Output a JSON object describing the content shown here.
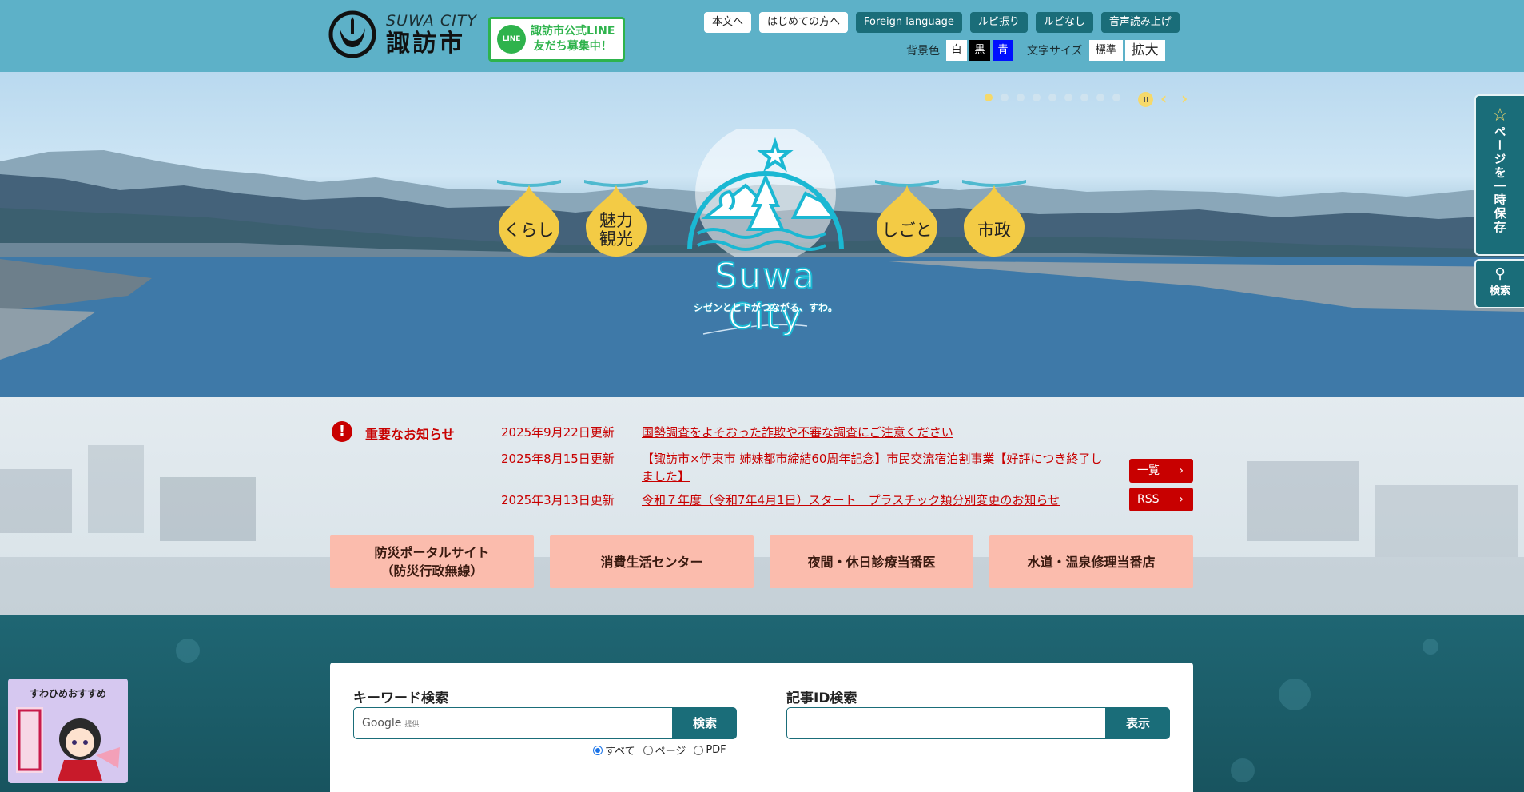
{
  "header": {
    "logo_en": "SUWA CITY",
    "logo_ja": "諏訪市",
    "line_banner": {
      "icon": "LINE",
      "line1": "諏訪市公式LINE",
      "line2": "友だち募集中！"
    },
    "util_buttons": [
      "本文へ",
      "はじめての方へ",
      "Foreign language",
      "ルビ振り",
      "ルビなし",
      "音声読み上げ"
    ],
    "bg_color_label": "背景色",
    "bg_colors": [
      "白",
      "黒",
      "青"
    ],
    "font_size_label": "文字サイズ",
    "font_sizes": [
      "標準",
      "拡大"
    ]
  },
  "hero": {
    "slide_count": 9,
    "active_slide": 0,
    "nav": [
      "くらし",
      "魅力\n観光",
      "しごと",
      "市政"
    ],
    "emblem_title": "Suwa City",
    "emblem_sub": "シゼンとヒトがつながる、すわ。"
  },
  "side_tabs": {
    "save": "ページを一時保存",
    "search": "検索"
  },
  "news": {
    "title": "重要なお知らせ",
    "items": [
      {
        "date": "2025年9月22日更新",
        "text": "国勢調査をよそおった詐欺や不審な調査にご注意ください"
      },
      {
        "date": "2025年8月15日更新",
        "text": "【諏訪市×伊東市 姉妹都市締結60周年記念】市民交流宿泊割事業【好評につき終了しました】"
      },
      {
        "date": "2025年3月13日更新",
        "text": "令和７年度（令和7年4月1日）スタート　プラスチック類分別変更のお知らせ"
      }
    ],
    "list_button": "一覧",
    "rss_button": "RSS",
    "quick_links": [
      "防災ポータルサイト\n（防災行政無線）",
      "消費生活センター",
      "夜間・休日診療当番医",
      "水道・温泉修理当番店"
    ]
  },
  "search": {
    "keyword_title": "キーワード検索",
    "keyword_placeholder_brand": "Google",
    "keyword_placeholder_suffix": "提供",
    "keyword_button": "検索",
    "scopes": [
      "すべて",
      "ページ",
      "PDF"
    ],
    "selected_scope": "すべて",
    "id_title": "記事ID検索",
    "id_button": "表示"
  },
  "suwahime": {
    "title": "すわひめおすすめ"
  },
  "colors": {
    "header": "#5db1c8",
    "accent": "#1a6d79",
    "alert": "#c80000",
    "pink": "#fbbcad",
    "gold": "#f5d96b"
  }
}
